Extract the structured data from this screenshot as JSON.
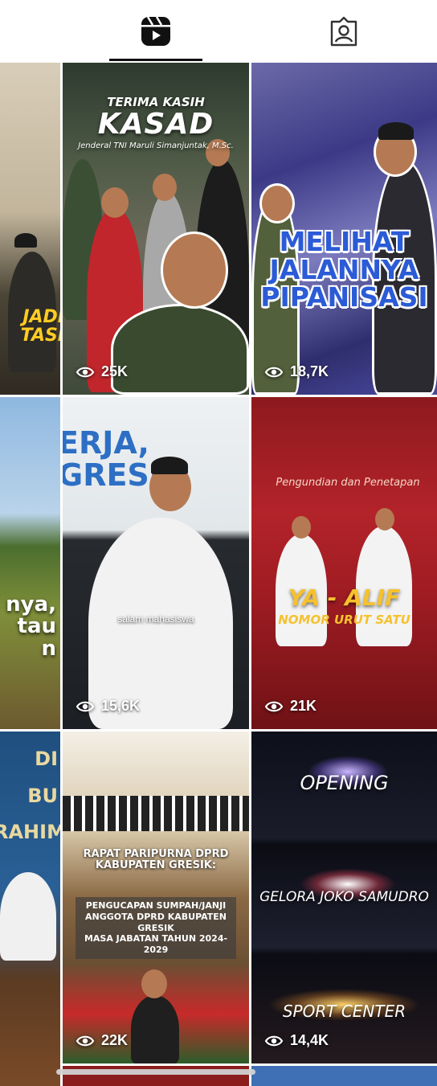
{
  "tabs": [
    {
      "name": "reels",
      "icon": "reels-icon",
      "active": true
    },
    {
      "name": "tagged",
      "icon": "tagged-person-icon",
      "active": false
    }
  ],
  "grid": {
    "tiles": [
      {
        "views": "",
        "overlay": "JADI\nTASI"
      },
      {
        "views": "25K",
        "title": "KASAD",
        "subtitle": "TERIMA KASIH",
        "caption": "Jenderal TNI Maruli Simanjuntak, M.Sc."
      },
      {
        "views": "18,7K",
        "headline": "MELIHAT\nJALANNYA\nPIPANISASI"
      },
      {
        "views": "",
        "overlay": "nya,\ntau\nn"
      },
      {
        "views": "15,6K",
        "banner": "ERJA, GRESIK",
        "caption": "salam mahasiswa"
      },
      {
        "views": "21K",
        "headline": "YA - ALIF",
        "subheadline": "NOMOR URUT SATU",
        "script": "Pengundian dan Penetapan"
      },
      {
        "views": "",
        "overlay": "DI\nBU\nRAHIM"
      },
      {
        "views": "22K",
        "headline": "RAPAT PARIPURNA DPRD\nKABUPATEN GRESIK:",
        "subheadline": "PENGUCAPAN SUMPAH/JANJI\nANGGOTA DPRD KABUPATEN GRESIK\nMASA JABATAN TAHUN 2024-2029"
      },
      {
        "views": "14,4K",
        "labels": [
          "OPENING",
          "GELORA JOKO SAMUDRO",
          "SPORT CENTER"
        ]
      }
    ]
  }
}
